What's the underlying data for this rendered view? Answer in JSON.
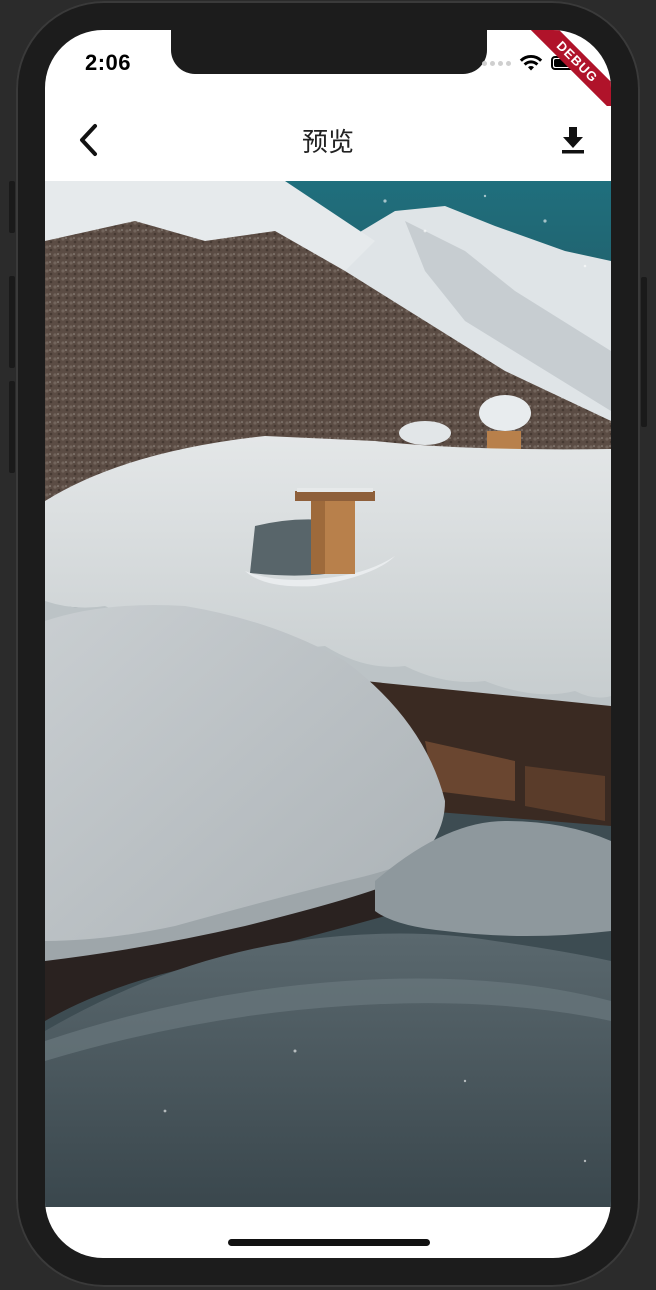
{
  "status_bar": {
    "time": "2:06",
    "icons": [
      "signal-dots-icon",
      "wifi-icon",
      "battery-icon"
    ]
  },
  "debug_banner": {
    "label": "DEBUG",
    "color": "#b0132a"
  },
  "app_bar": {
    "title": "预览",
    "back_icon": "chevron-left-icon",
    "download_icon": "download-icon"
  },
  "preview_image": {
    "subject": "snow-covered-cabins-mountains",
    "colors": {
      "sky": "#1f6f7d",
      "snow": "#d8dde0",
      "shadow_snow": "#4c5a61",
      "chimney": "#b8804b",
      "wood": "#3a2a22"
    }
  }
}
